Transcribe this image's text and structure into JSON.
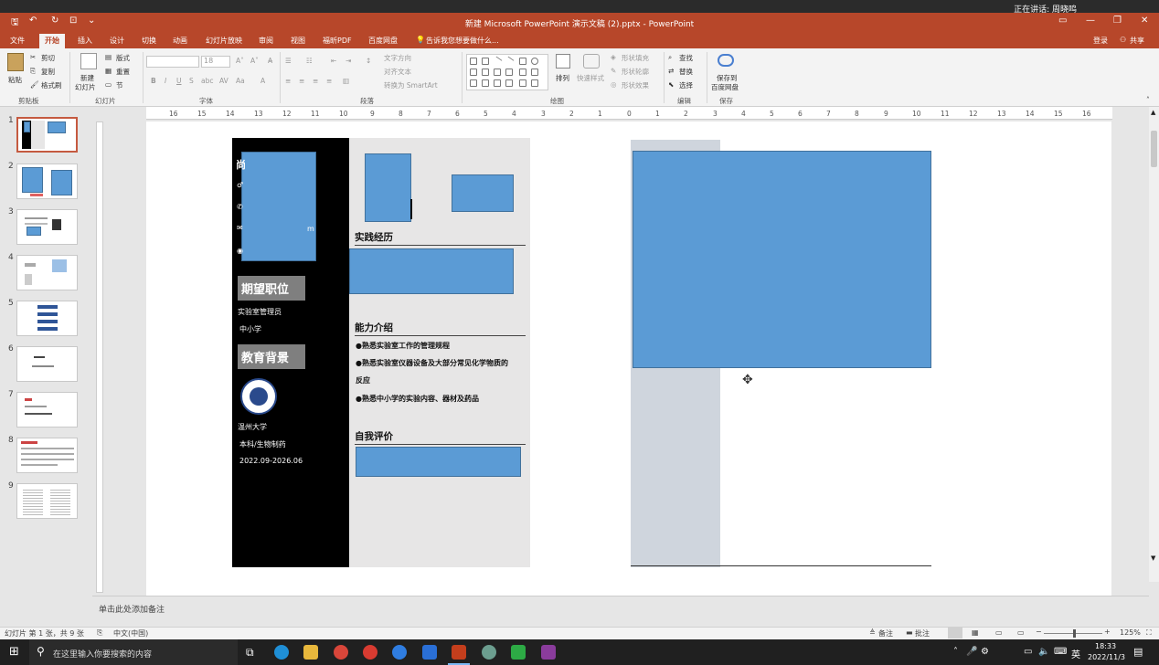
{
  "title_bar": {
    "title": "新建 Microsoft PowerPoint 演示文稿 (2).pptx - PowerPoint",
    "notification": "正在讲话: 周晓鸣"
  },
  "menu": {
    "tabs": [
      "文件",
      "开始",
      "插入",
      "设计",
      "切换",
      "动画",
      "幻灯片放映",
      "审阅",
      "视图",
      "福昕PDF",
      "百度网盘"
    ],
    "active_tab": "开始",
    "tell_me": "告诉我您想要做什么...",
    "login": "登录",
    "share": "共享"
  },
  "ribbon": {
    "clipboard": {
      "paste": "粘贴",
      "cut": "剪切",
      "copy": "复制",
      "format_painter": "格式刷",
      "group": "剪贴板"
    },
    "slides": {
      "new_slide_1": "新建",
      "new_slide_2": "幻灯片",
      "layout": "版式",
      "reset": "重置",
      "section": "节",
      "group": "幻灯片"
    },
    "font": {
      "size": "18",
      "group": "字体"
    },
    "paragraph": {
      "text_direction": "文字方向",
      "align_text": "对齐文本",
      "smartart": "转换为 SmartArt",
      "group": "段落"
    },
    "drawing": {
      "arrange": "排列",
      "quick_styles": "快速样式",
      "shape_fill": "形状填充",
      "shape_outline": "形状轮廓",
      "shape_effects": "形状效果",
      "group": "绘图"
    },
    "editing": {
      "find": "查找",
      "replace": "替换",
      "select": "选择",
      "group": "编辑"
    },
    "save": {
      "label_1": "保存到",
      "label_2": "百度网盘",
      "group": "保存"
    }
  },
  "ruler_labels": [
    "16",
    "15",
    "14",
    "13",
    "12",
    "11",
    "10",
    "9",
    "8",
    "7",
    "6",
    "5",
    "4",
    "3",
    "2",
    "1",
    "0",
    "1",
    "2",
    "3",
    "4",
    "5",
    "6",
    "7",
    "8",
    "9",
    "10",
    "11",
    "12",
    "13",
    "14",
    "15",
    "16"
  ],
  "thumbnails": [
    "1",
    "2",
    "3",
    "4",
    "5",
    "6",
    "7",
    "8",
    "9"
  ],
  "selected_slide": "1",
  "resume": {
    "sidebar_clip": "m",
    "job_heading": "期望职位",
    "job_lines": [
      "实验室管理员",
      "中小学"
    ],
    "edu_heading": "教育背景",
    "edu_lines": [
      "温州大学",
      "本科/生物制药",
      "2022.09-2026.06"
    ],
    "practice_title": "实践经历",
    "ability_title": "能力介绍",
    "ability_items": [
      "●熟悉实验室工作的管理规程",
      "●熟悉实验室仪器设备及大部分常见化学物质的",
      "反应",
      "●熟悉中小学的实验内容、器材及药品"
    ],
    "self_eval_title": "自我评价"
  },
  "notes_placeholder": "单击此处添加备注",
  "status": {
    "slide_info": "幻灯片 第 1 张，共 9 张",
    "language": "中文(中国)",
    "notes_btn": "备注",
    "comments_btn": "批注",
    "zoom": "125%"
  },
  "taskbar": {
    "search_placeholder": "在这里输入你要搜索的内容",
    "ime": "英",
    "time": "18:33",
    "date": "2022/11/3"
  }
}
